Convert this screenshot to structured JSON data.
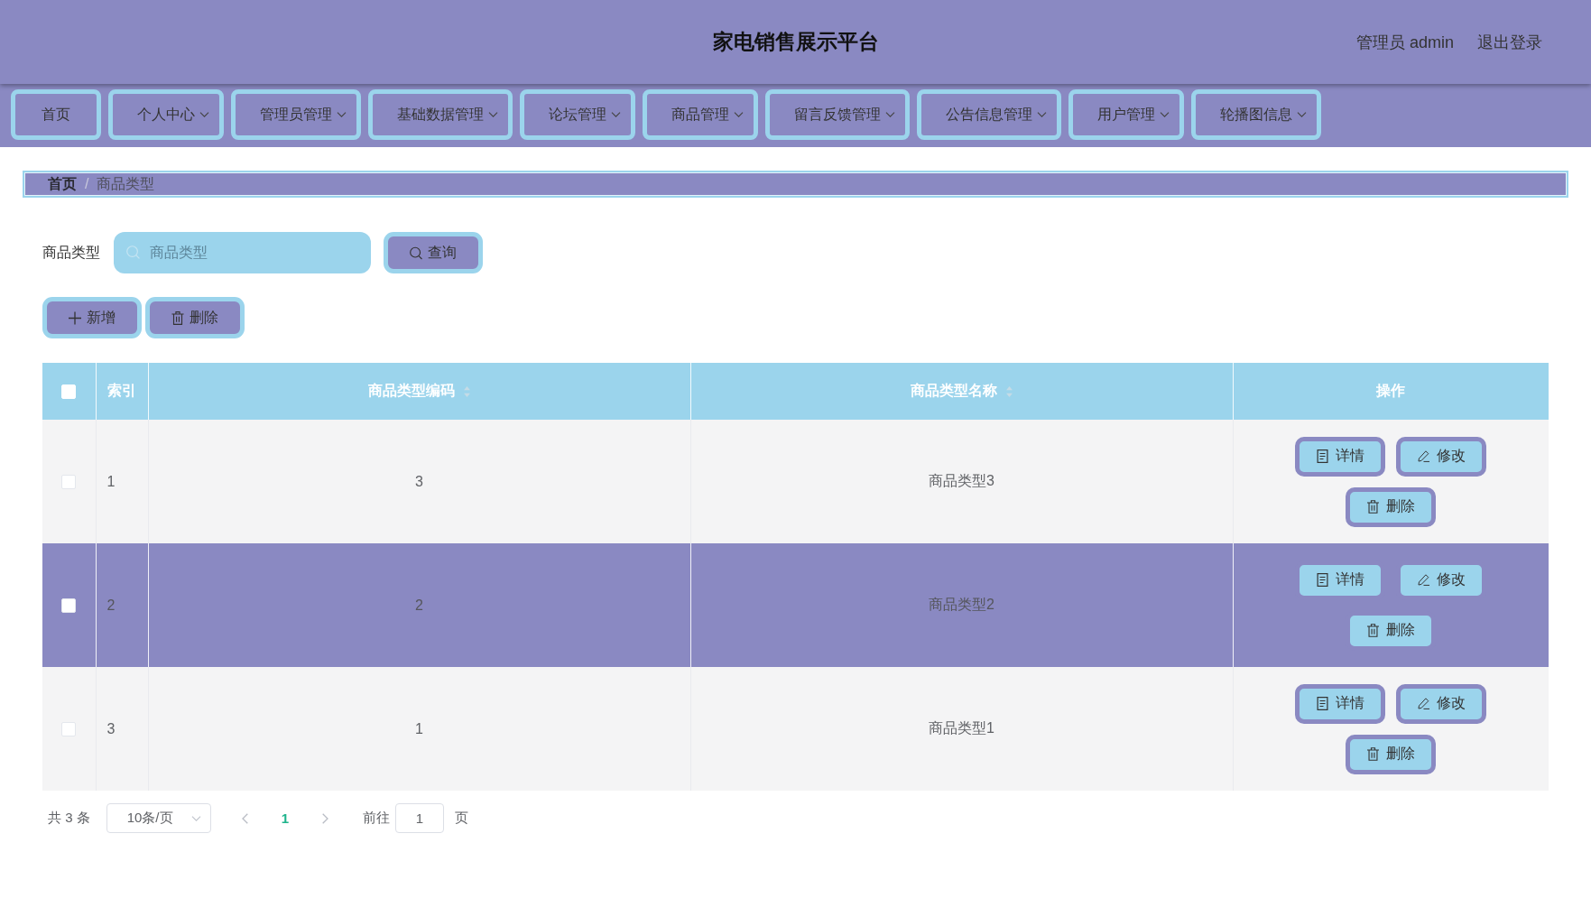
{
  "header": {
    "title": "家电销售展示平台",
    "user_label": "管理员 admin",
    "logout": "退出登录"
  },
  "nav": [
    {
      "label": "首页",
      "has_dropdown": false
    },
    {
      "label": "个人中心",
      "has_dropdown": true
    },
    {
      "label": "管理员管理",
      "has_dropdown": true
    },
    {
      "label": "基础数据管理",
      "has_dropdown": true
    },
    {
      "label": "论坛管理",
      "has_dropdown": true
    },
    {
      "label": "商品管理",
      "has_dropdown": true
    },
    {
      "label": "留言反馈管理",
      "has_dropdown": true
    },
    {
      "label": "公告信息管理",
      "has_dropdown": true
    },
    {
      "label": "用户管理",
      "has_dropdown": true
    },
    {
      "label": "轮播图信息",
      "has_dropdown": true
    }
  ],
  "breadcrumb": {
    "separator": "/",
    "items": [
      {
        "label": "首页",
        "current": false
      },
      {
        "label": "商品类型",
        "current": true
      }
    ]
  },
  "search": {
    "label": "商品类型",
    "placeholder": "商品类型",
    "button": {
      "kind": "search",
      "label": "查询"
    }
  },
  "toolbar": [
    {
      "kind": "add",
      "label": "新增"
    },
    {
      "kind": "delete",
      "label": "删除"
    }
  ],
  "table": {
    "select_all": {
      "checked": false
    },
    "columns": [
      {
        "label": "索引",
        "sortable": false
      },
      {
        "label": "商品类型编码",
        "sortable": true
      },
      {
        "label": "商品类型名称",
        "sortable": true
      },
      {
        "label": "操作",
        "sortable": false
      }
    ],
    "rows": [
      {
        "selected": false,
        "checked": false,
        "cells": [
          "1",
          "3",
          "商品类型3"
        ],
        "actions": [
          {
            "kind": "detail",
            "label": "详情"
          },
          {
            "kind": "edit",
            "label": "修改"
          },
          {
            "kind": "delete",
            "label": "删除"
          }
        ]
      },
      {
        "selected": true,
        "checked": false,
        "cells": [
          "2",
          "2",
          "商品类型2"
        ],
        "actions": [
          {
            "kind": "detail",
            "label": "详情"
          },
          {
            "kind": "edit",
            "label": "修改"
          },
          {
            "kind": "delete",
            "label": "删除"
          }
        ]
      },
      {
        "selected": false,
        "checked": false,
        "cells": [
          "3",
          "1",
          "商品类型1"
        ],
        "actions": [
          {
            "kind": "detail",
            "label": "详情"
          },
          {
            "kind": "edit",
            "label": "修改"
          },
          {
            "kind": "delete",
            "label": "删除"
          }
        ]
      }
    ]
  },
  "pagination": {
    "total": "共 3 条",
    "page_size": "10条/页",
    "pages": [
      {
        "label": "1",
        "selected": true
      }
    ],
    "goto_label": "前往",
    "goto_value": "1",
    "goto_suffix": "页"
  }
}
